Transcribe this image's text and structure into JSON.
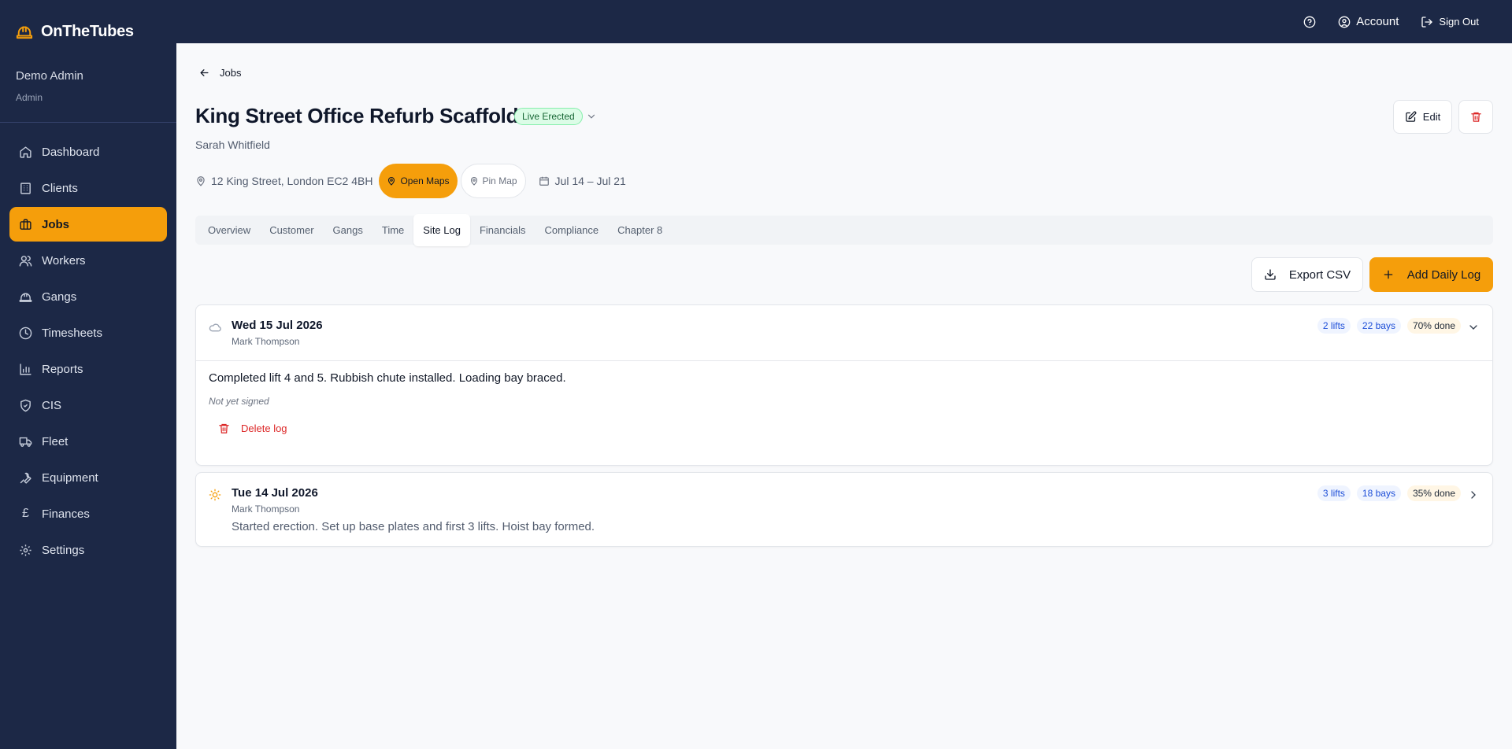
{
  "app": {
    "name": "OnTheTubes"
  },
  "topbar": {
    "account_label": "Account",
    "signout_label": "Sign Out"
  },
  "user": {
    "name": "Demo Admin",
    "role": "Admin"
  },
  "nav": [
    {
      "label": "Dashboard",
      "icon": "home-icon"
    },
    {
      "label": "Clients",
      "icon": "building-icon"
    },
    {
      "label": "Jobs",
      "icon": "briefcase-icon",
      "active": true
    },
    {
      "label": "Workers",
      "icon": "users-icon"
    },
    {
      "label": "Gangs",
      "icon": "hardhat-icon"
    },
    {
      "label": "Timesheets",
      "icon": "clock-icon"
    },
    {
      "label": "Reports",
      "icon": "bar-chart-icon"
    },
    {
      "label": "CIS",
      "icon": "shield-icon"
    },
    {
      "label": "Fleet",
      "icon": "truck-icon"
    },
    {
      "label": "Equipment",
      "icon": "wrench-icon"
    },
    {
      "label": "Finances",
      "icon": "pound-icon"
    },
    {
      "label": "Settings",
      "icon": "gear-icon"
    }
  ],
  "job": {
    "back_label": "Jobs",
    "title": "King Street Office Refurb Scaffold",
    "status": "Live Erected",
    "customer": "Sarah Whitfield",
    "address": "12 King Street, London EC2 4BH",
    "open_maps_label": "Open Maps",
    "pin_map_label": "Pin Map",
    "dates": "Jul 14 – Jul 21",
    "edit_label": "Edit"
  },
  "tabs": [
    "Overview",
    "Customer",
    "Gangs",
    "Time",
    "Site Log",
    "Financials",
    "Compliance",
    "Chapter 8"
  ],
  "active_tab": "Site Log",
  "toolbar": {
    "export_label": "Export CSV",
    "add_label": "Add Daily Log"
  },
  "logs": [
    {
      "date": "Wed 15 Jul 2026",
      "author": "Mark Thompson",
      "weather_icon": "cloud-icon",
      "lifts": "2 lifts",
      "bays": "22 bays",
      "done": "70% done",
      "expanded": true,
      "notes": "Completed lift 4 and 5. Rubbish chute installed. Loading bay braced.",
      "signed_status": "Not yet signed",
      "delete_label": "Delete log"
    },
    {
      "date": "Tue 14 Jul 2026",
      "author": "Mark Thompson",
      "weather_icon": "sun-icon",
      "lifts": "3 lifts",
      "bays": "18 bays",
      "done": "35% done",
      "expanded": false,
      "summary": "Started erection. Set up base plates and first 3 lifts. Hoist bay formed."
    }
  ],
  "colors": {
    "sidebar": "#1c2846",
    "accent": "#f59e0b",
    "status_green": "#166534",
    "danger": "#dc2626",
    "chip_blue": "#1d4ed8"
  }
}
